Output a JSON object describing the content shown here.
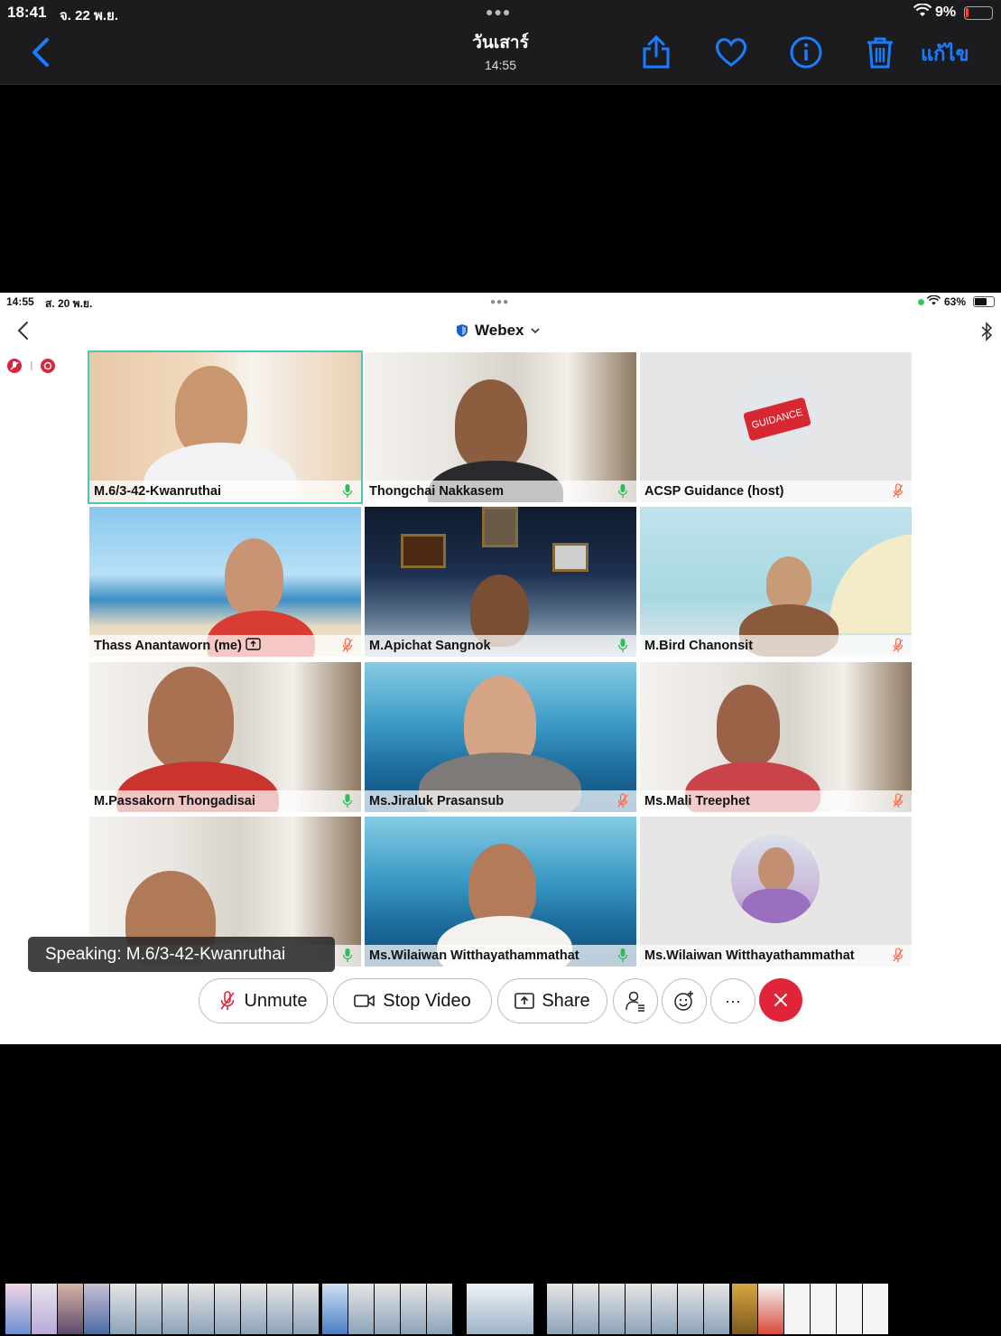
{
  "photos_status": {
    "time": "18:41",
    "date": "จ. 22 พ.ย.",
    "battery": "9%"
  },
  "photos_nav": {
    "title": "วันเสาร์",
    "subtitle": "14:55",
    "edit_label": "แก้ไข"
  },
  "ipad_status": {
    "time": "14:55",
    "date": "ส. 20 พ.ย.",
    "battery": "63%"
  },
  "webex": {
    "title": "Webex"
  },
  "participants": [
    {
      "name": "M.6/3-42-Kwanruthai",
      "mic": "on"
    },
    {
      "name": "Thongchai Nakkasem",
      "mic": "on"
    },
    {
      "name": "ACSP Guidance (host)",
      "mic": "muted"
    },
    {
      "name": "Thass Anantaworn (me)",
      "mic": "muted"
    },
    {
      "name": "M.Apichat Sangnok",
      "mic": "on"
    },
    {
      "name": "M.Bird Chanonsit",
      "mic": "muted"
    },
    {
      "name": "M.Passakorn Thongadisai",
      "mic": "on"
    },
    {
      "name": "Ms.Jiraluk Prasansub",
      "mic": "muted"
    },
    {
      "name": "Ms.Mali Treephet",
      "mic": "muted"
    },
    {
      "name": "",
      "mic": "on"
    },
    {
      "name": "Ms.Wilaiwan Witthayathammathat",
      "mic": "on"
    },
    {
      "name": "Ms.Wilaiwan Witthayathammathat",
      "mic": "muted"
    }
  ],
  "guidance_logo": "GUIDANCE",
  "speaking_label": "Speaking: M.6/3-42-Kwanruthai",
  "controls": {
    "unmute": "Unmute",
    "stop_video": "Stop Video",
    "share": "Share",
    "more": "···"
  },
  "colors": {
    "accent": "#1a7cff",
    "active_speaker": "#48c9b0",
    "end_call": "#e0243a",
    "mic_on": "#2ebd59",
    "mic_muted": "#ff6b4a"
  }
}
